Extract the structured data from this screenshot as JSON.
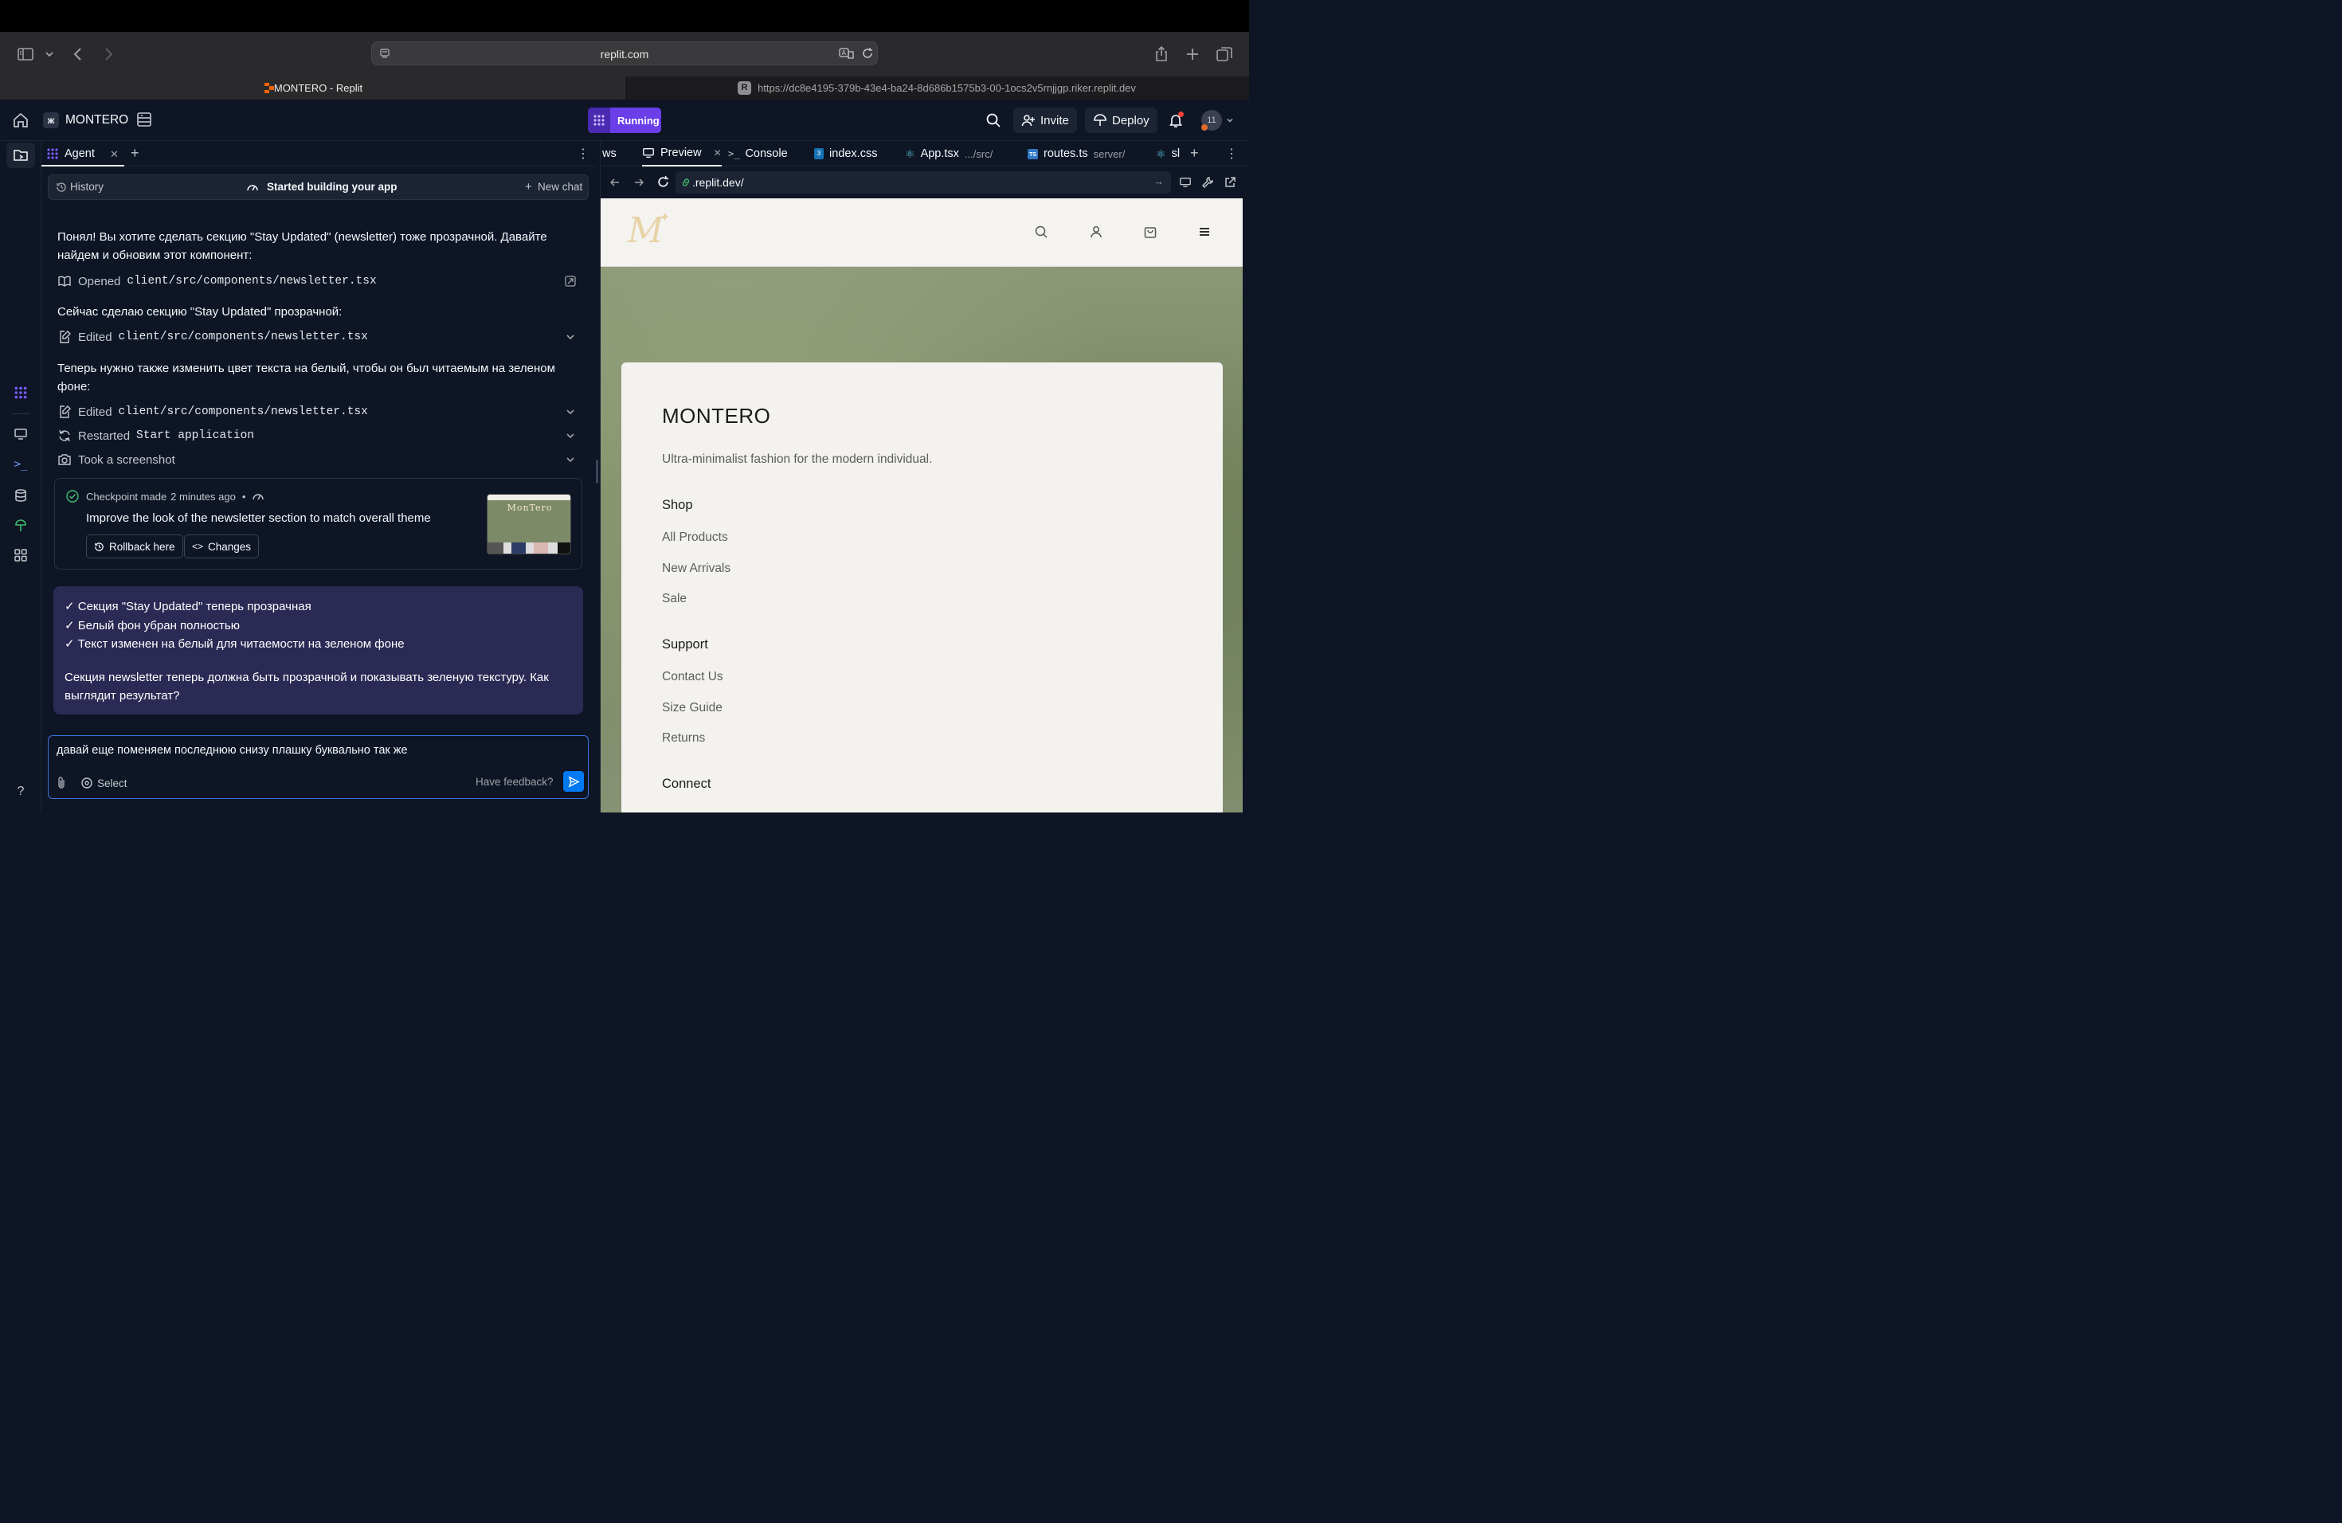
{
  "browser": {
    "url": "replit.com",
    "tabs": [
      {
        "title": "MONTERO - Replit"
      },
      {
        "title": "https://dc8e4195-379b-43e4-ba24-8d686b1575b3-00-1ocs2v5rnjjgp.riker.replit.dev"
      }
    ]
  },
  "header": {
    "project_name": "MONTERO",
    "status": "Running",
    "invite_label": "Invite",
    "deploy_label": "Deploy",
    "avatar_text": "11"
  },
  "agent": {
    "tab_label": "Agent",
    "history_label": "History",
    "status_label": "Started building your app",
    "new_chat_label": "New chat",
    "messages": [
      {
        "text": "Понял! Вы хотите сделать секцию \"Stay Updated\" (newsletter) тоже прозрачной. Давайте найдем и обновим этот компонент:"
      },
      {
        "text": "Сейчас сделаю секцию \"Stay Updated\" прозрачной:"
      },
      {
        "text": "Теперь нужно также изменить цвет текста на белый, чтобы он был читаемым на зеленом фоне:"
      }
    ],
    "actions": [
      {
        "verb": "Opened",
        "target": "client/src/components/newsletter.tsx"
      },
      {
        "verb": "Edited",
        "target": "client/src/components/newsletter.tsx"
      },
      {
        "verb": "Edited",
        "target": "client/src/components/newsletter.tsx"
      },
      {
        "verb": "Restarted",
        "target": "Start application"
      },
      {
        "verb": "Took a screenshot",
        "target": ""
      }
    ],
    "checkpoint": {
      "label": "Checkpoint made",
      "time": "2 minutes ago",
      "separator": "•",
      "description": "Improve the look of the newsletter section to match overall theme",
      "rollback_label": "Rollback here",
      "changes_label": "Changes",
      "thumb_logo": "MonTero"
    },
    "summary": {
      "items": [
        "✓ Секция \"Stay Updated\" теперь прозрачная",
        "✓ Белый фон убран полностью",
        "✓ Текст изменен на белый для читаемости на зеленом фоне"
      ],
      "closing": "Секция newsletter теперь должна быть прозрачной и показывать зеленую текстуру. Как выглядит результат?"
    },
    "input": {
      "value": "давай еще поменяем последнюю снизу плашку буквально так же",
      "select_label": "Select",
      "feedback_label": "Have feedback?"
    }
  },
  "workspace": {
    "tabs": [
      {
        "label": "ws"
      },
      {
        "label": "Preview"
      },
      {
        "label": "Console"
      },
      {
        "label": "index.css"
      },
      {
        "label": "App.tsx",
        "path": ".../src/"
      },
      {
        "label": "routes.ts",
        "path": "server/"
      },
      {
        "label": "sl"
      }
    ],
    "preview_url": ".replit.dev/"
  },
  "site": {
    "logo": "M",
    "brand": "MONTERO",
    "tagline": "Ultra-minimalist fashion for the modern individual.",
    "sections": [
      {
        "heading": "Shop",
        "links": [
          "All Products",
          "New Arrivals",
          "Sale"
        ]
      },
      {
        "heading": "Support",
        "links": [
          "Contact Us",
          "Size Guide",
          "Returns"
        ]
      },
      {
        "heading": "Connect",
        "links": []
      }
    ]
  },
  "colors": {
    "ide_bg": "#0e1525",
    "running_purple": "#6a3ee8",
    "summary_bg": "#2b2a55",
    "input_border": "#3b74e0",
    "card_bg": "#f3f2ee"
  }
}
